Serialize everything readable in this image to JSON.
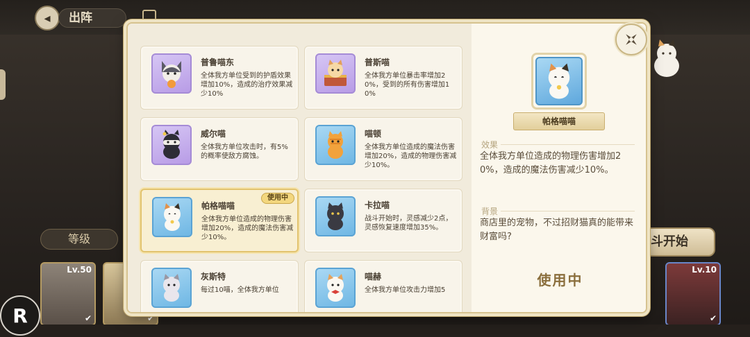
{
  "header": {
    "title": "出阵"
  },
  "background": {
    "level_button": "等级",
    "start_button": "斗开始",
    "hero_cards": [
      {
        "level": "Lv.50"
      },
      {
        "level": "Lv.10"
      }
    ]
  },
  "pets": [
    {
      "name": "普鲁喵东",
      "desc": "全体我方单位受到的护盾效果增加10%，造成的治疗效果减少10%",
      "frame": "purple",
      "selected": false,
      "badge": ""
    },
    {
      "name": "普斯喵",
      "desc": "全体我方单位暴击率增加20%，受到的所有伤害增加10%",
      "frame": "purple",
      "selected": false,
      "badge": ""
    },
    {
      "name": "威尔喵",
      "desc": "全体我方单位攻击时，有5%的概率使敌方腐蚀。",
      "frame": "purple",
      "selected": false,
      "badge": ""
    },
    {
      "name": "喵顿",
      "desc": "全体我方单位造成的魔法伤害增加20%，造成的物理伤害减少10%。",
      "frame": "blue",
      "selected": false,
      "badge": ""
    },
    {
      "name": "帕格喵喵",
      "desc": "全体我方单位造成的物理伤害增加20%，造成的魔法伤害减少10%。",
      "frame": "blue",
      "selected": true,
      "badge": "使用中"
    },
    {
      "name": "卡拉喵",
      "desc": "战斗开始时，灵感减少2点，灵感恢复速度增加35%。",
      "frame": "blue",
      "selected": false,
      "badge": ""
    },
    {
      "name": "灰斯特",
      "desc": "每过10喵，全体我方单位",
      "frame": "blue",
      "selected": false,
      "badge": ""
    },
    {
      "name": "喵赫",
      "desc": "全体我方单位攻击力增加5",
      "frame": "blue",
      "selected": false,
      "badge": ""
    }
  ],
  "detail": {
    "name": "帕格喵喵",
    "effect_label": "效果",
    "effect_text": "全体我方单位造成的物理伤害增加20%，造成的魔法伤害减少10%。",
    "background_label": "背景",
    "background_text": "商店里的宠物，不过招财猫真的能带来财富吗?",
    "status": "使用中"
  },
  "colors": {
    "accent_gold": "#e2c36e",
    "frame_purple": "#b89ce6",
    "frame_blue": "#6fb7e4"
  }
}
